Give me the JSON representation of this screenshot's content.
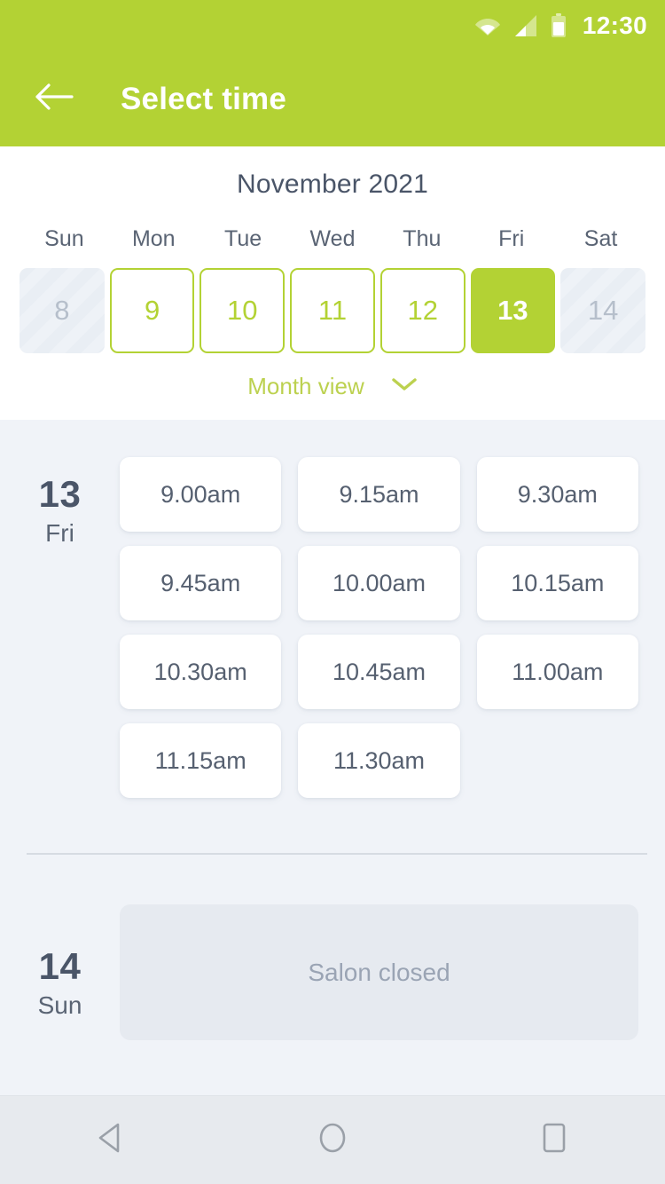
{
  "status_bar": {
    "time": "12:30",
    "icons": [
      "wifi-icon",
      "signal-icon",
      "battery-icon"
    ]
  },
  "app_bar": {
    "back_icon": "arrow-left-icon",
    "title": "Select time"
  },
  "calendar": {
    "month_title": "November 2021",
    "weekdays": [
      "Sun",
      "Mon",
      "Tue",
      "Wed",
      "Thu",
      "Fri",
      "Sat"
    ],
    "days": [
      {
        "number": "8",
        "state": "disabled"
      },
      {
        "number": "9",
        "state": "available"
      },
      {
        "number": "10",
        "state": "available"
      },
      {
        "number": "11",
        "state": "available"
      },
      {
        "number": "12",
        "state": "available"
      },
      {
        "number": "13",
        "state": "selected"
      },
      {
        "number": "14",
        "state": "disabled"
      }
    ],
    "month_view_label": "Month view",
    "month_view_icon": "chevron-down-icon"
  },
  "schedule": {
    "groups": [
      {
        "day_number": "13",
        "day_name": "Fri",
        "type": "slots",
        "slots": [
          "9.00am",
          "9.15am",
          "9.30am",
          "9.45am",
          "10.00am",
          "10.15am",
          "10.30am",
          "10.45am",
          "11.00am",
          "11.15am",
          "11.30am"
        ]
      },
      {
        "day_number": "14",
        "day_name": "Sun",
        "type": "closed",
        "closed_label": "Salon closed"
      }
    ]
  },
  "nav_bar": {
    "back_icon": "triangle-back-icon",
    "home_icon": "circle-home-icon",
    "recents_icon": "square-recents-icon"
  },
  "colors": {
    "accent_green": "#b3d234",
    "accent_green_light": "#bcd14f",
    "text_dark": "#4a5568",
    "text_muted": "#9aa4b4",
    "page_bg": "#f0f3f8",
    "card_bg": "#ffffff"
  }
}
